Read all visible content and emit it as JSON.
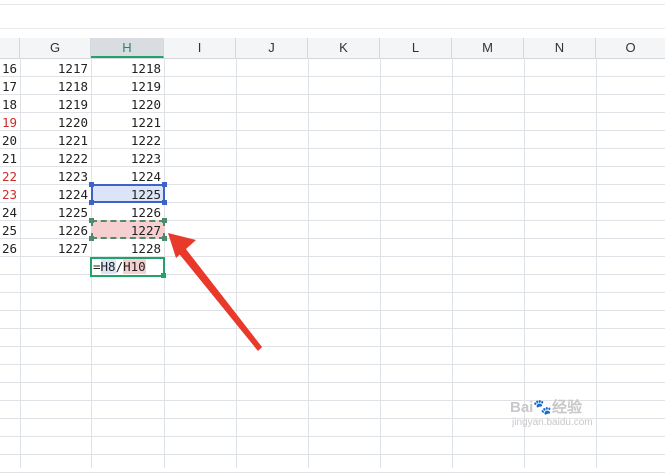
{
  "columns": [
    "G",
    "H",
    "I",
    "J",
    "K",
    "L",
    "M",
    "N",
    "O"
  ],
  "active_column": "H",
  "rows": [
    {
      "f": "16",
      "f_red": false,
      "g": "1217",
      "h": "1218"
    },
    {
      "f": "17",
      "f_red": false,
      "g": "1218",
      "h": "1219"
    },
    {
      "f": "18",
      "f_red": false,
      "g": "1219",
      "h": "1220"
    },
    {
      "f": "19",
      "f_red": true,
      "g": "1220",
      "h": "1221"
    },
    {
      "f": "20",
      "f_red": false,
      "g": "1221",
      "h": "1222"
    },
    {
      "f": "21",
      "f_red": false,
      "g": "1222",
      "h": "1223"
    },
    {
      "f": "22",
      "f_red": true,
      "g": "1223",
      "h": "1224"
    },
    {
      "f": "23",
      "f_red": true,
      "g": "1224",
      "h": "1225"
    },
    {
      "f": "24",
      "f_red": false,
      "g": "1225",
      "h": "1226"
    },
    {
      "f": "25",
      "f_red": false,
      "g": "1226",
      "h": "1227"
    },
    {
      "f": "26",
      "f_red": false,
      "g": "1227",
      "h": "1228"
    }
  ],
  "formula": {
    "eq": "=",
    "ref1": "H8",
    "op": "/",
    "ref2": "H10"
  },
  "watermark": {
    "line1": "Bai🐾经验",
    "line2": "jingyan.baidu.com"
  },
  "colors": {
    "active_green": "#22a367",
    "ref_blue": "#3f62c6",
    "ref_red_fill": "#f6cfd0",
    "arrow": "#e8392b",
    "red_text": "#d12b2b"
  }
}
